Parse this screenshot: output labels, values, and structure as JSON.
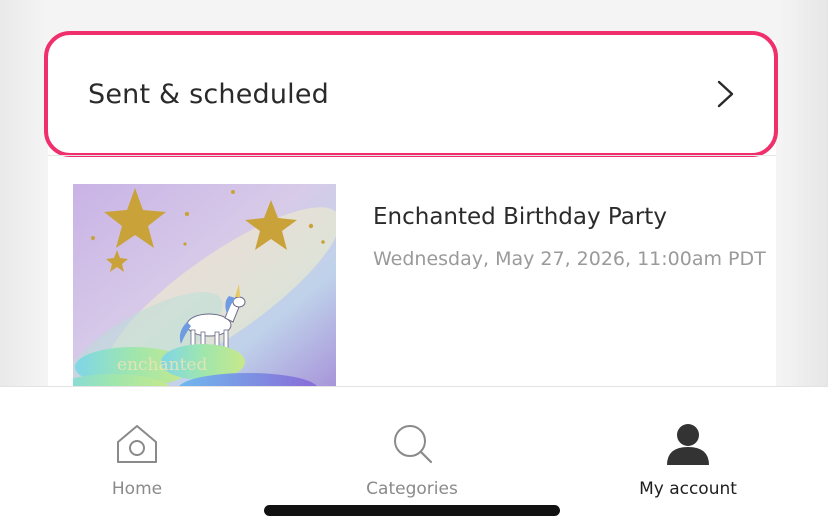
{
  "section": {
    "title": "Sent & scheduled"
  },
  "event": {
    "title": "Enchanted Birthday Party",
    "date": "Wednesday, May 27, 2026, 11:00am PDT",
    "thumbnail_text": "enchanted"
  },
  "tabbar": {
    "tabs": [
      {
        "label": "Home",
        "icon": "home-icon",
        "active": false
      },
      {
        "label": "Categories",
        "icon": "search-icon",
        "active": false
      },
      {
        "label": "My account",
        "icon": "person-icon",
        "active": true
      }
    ]
  },
  "colors": {
    "highlight": "#f0306d",
    "active_tab": "#1f1f1f",
    "inactive_tab": "#8a8a8a"
  }
}
